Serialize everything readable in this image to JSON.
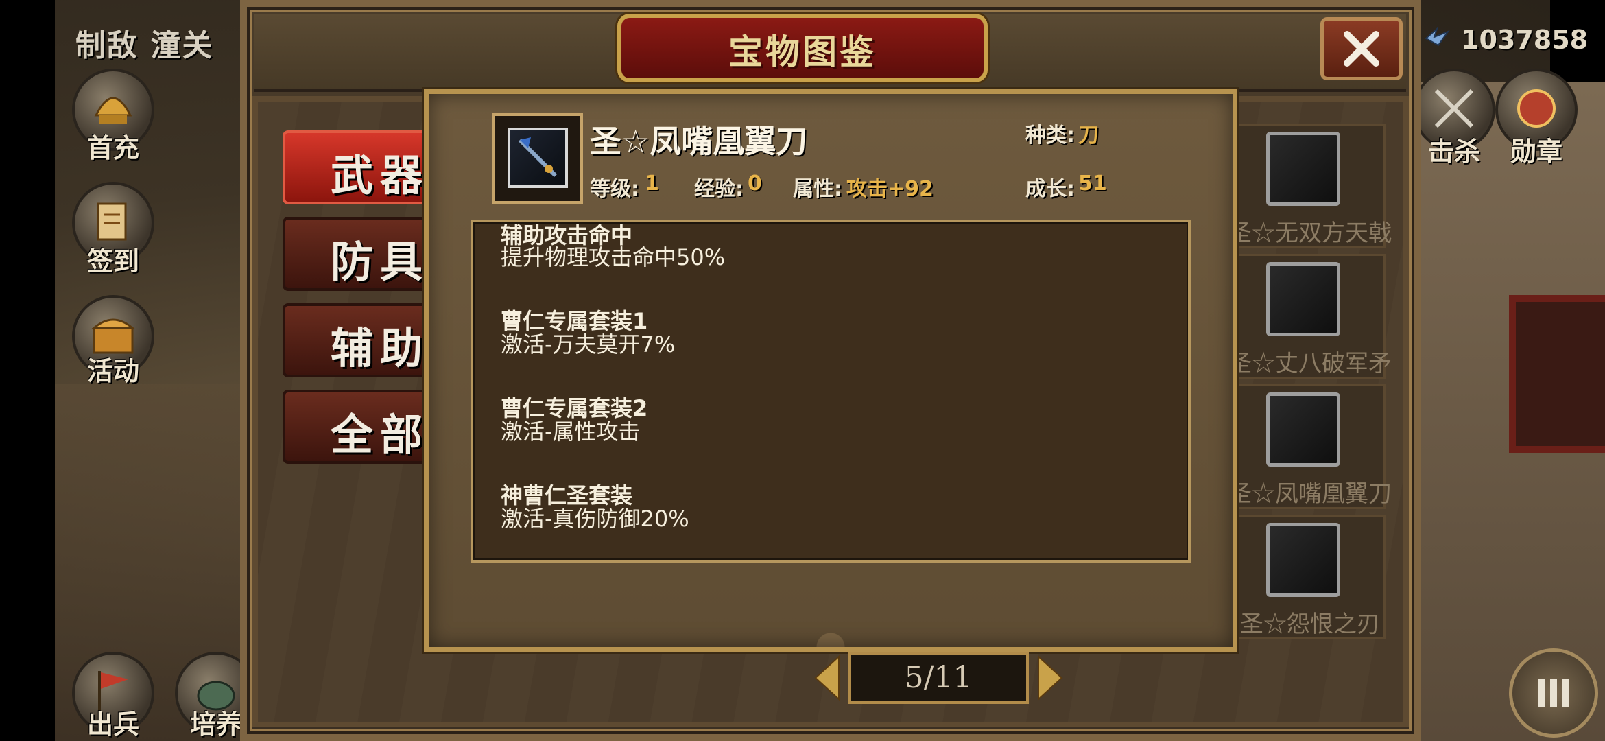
{
  "top_bar": {
    "location": "制敌 潼关",
    "currency_value": "1037858"
  },
  "left_menu": [
    {
      "label": "首充",
      "icon": "helmet-icon"
    },
    {
      "label": "签到",
      "icon": "scroll-icon"
    },
    {
      "label": "活动",
      "icon": "chest-icon"
    },
    {
      "label": "出兵",
      "icon": "flag-icon"
    },
    {
      "label": "培养",
      "icon": "pot-icon"
    }
  ],
  "right_menu": [
    {
      "label": "击杀",
      "icon": "crossed-swords-icon"
    },
    {
      "label": "勋章",
      "icon": "medal-icon"
    }
  ],
  "dialog": {
    "title": "宝物图鉴",
    "close_icon": "close-icon"
  },
  "category_tabs": [
    {
      "label": "武器",
      "active": true
    },
    {
      "label": "防具",
      "active": false
    },
    {
      "label": "辅助",
      "active": false
    },
    {
      "label": "全部",
      "active": false
    }
  ],
  "item_list": [
    {
      "name": "圣☆无双方天戟"
    },
    {
      "name": "圣☆丈八破军矛"
    },
    {
      "name": "圣☆凤嘴凰翼刀"
    },
    {
      "name": "圣☆怨恨之刃"
    }
  ],
  "detail": {
    "name": "圣☆凤嘴凰翼刀",
    "type_label": "种类:",
    "type_value": "刀",
    "level_label": "等级:",
    "level_value": "1",
    "exp_label": "经验:",
    "exp_value": "0",
    "attr_label": "属性:",
    "attr_value": "攻击+92",
    "growth_label": "成长:",
    "growth_value": "51",
    "effects": [
      {
        "title": "辅助攻击命中",
        "text": "提升物理攻击命中50%"
      },
      {
        "title": "曹仁专属套装1",
        "text": "激活-万夫莫开7%"
      },
      {
        "title": "曹仁专属套装2",
        "text": "激活-属性攻击"
      },
      {
        "title": "神曹仁圣套装",
        "text": "激活-真伤防御20%"
      }
    ]
  },
  "pager": {
    "text": "5/11"
  },
  "colors": {
    "accent_gold": "#e8b44a",
    "tab_active_red": "#d6372a",
    "frame_gold": "#b7934f"
  }
}
